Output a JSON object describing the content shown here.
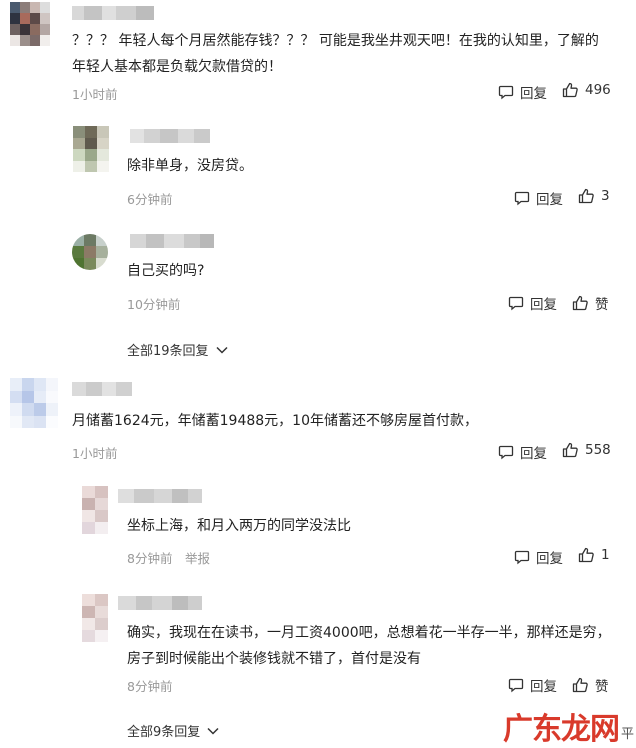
{
  "comments": [
    {
      "text": "？？？ 年轻人每个月居然能存钱？？？ 可能是我坐井观天吧！在我的认知里，了解的年轻人基本都是负载欠款借贷的！",
      "time": "1小时前",
      "reply_label": "回复",
      "likes": "496",
      "replies": [
        {
          "text": "除非单身，没房贷。",
          "time": "6分钟前",
          "reply_label": "回复",
          "likes": "3"
        },
        {
          "text": "自己买的吗?",
          "time": "10分钟前",
          "reply_label": "回复",
          "likes": "赞"
        }
      ],
      "more_replies": "全部19条回复"
    },
    {
      "text": "月储蓄1624元，年储蓄19488元，10年储蓄还不够房屋首付款，",
      "time": "1小时前",
      "reply_label": "回复",
      "likes": "558",
      "replies": [
        {
          "text": "坐标上海，和月入两万的同学没法比",
          "time": "8分钟前",
          "report": "举报",
          "reply_label": "回复",
          "likes": "1"
        },
        {
          "text": "确实，我现在在读书，一月工资4000吧，总想着花一半存一半，那样还是穷，房子到时候能出个装修钱就不错了，首付是没有",
          "time": "8分钟前",
          "reply_label": "回复",
          "likes": "赞"
        }
      ],
      "more_replies": "全部9条回复"
    }
  ],
  "watermark": {
    "main": "广东龙网",
    "small": "平"
  },
  "colors": {
    "meta": "#999999",
    "text": "#222222",
    "watermark": "#d93a2b"
  },
  "icons": {
    "reply": "comment-bubble-icon",
    "like": "thumbs-up-icon",
    "expand": "chevron-down-icon"
  }
}
